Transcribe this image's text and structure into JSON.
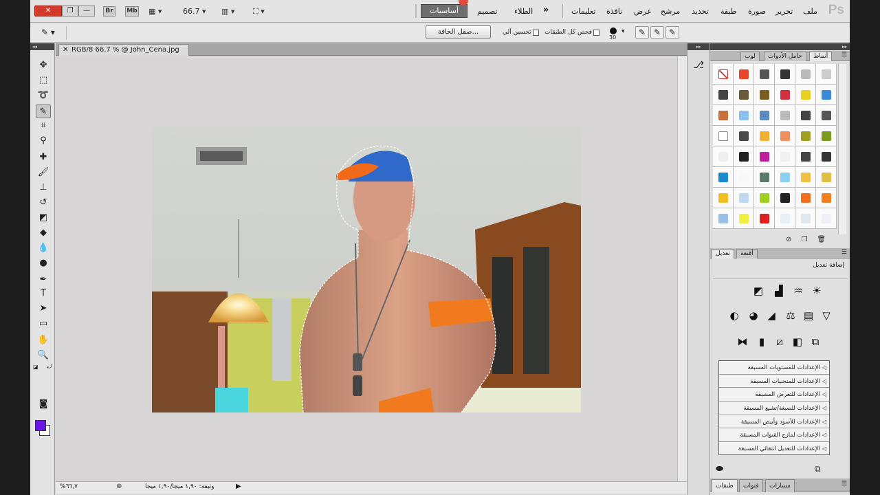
{
  "menubar": {
    "close_glyph": "✕",
    "restore_glyph": "❐",
    "minimize_glyph": "—",
    "bridge_label": "Br",
    "minibridge_label": "Mb",
    "zoom_value": "66.7",
    "workspace_active": "أساسيات",
    "workspace_design": "تصميم",
    "workspace_more": "الطلاء",
    "more_glyph": "»",
    "items": [
      "تعليمات",
      "نافذة",
      "عرض",
      "مرشح",
      "تحديد",
      "طبقة",
      "صورة",
      "تحرير",
      "ملف"
    ],
    "ps_logo": "Ps"
  },
  "options": {
    "refine_edge": "صقل الحافة...",
    "auto_enhance": "تحسين آلي",
    "sample_all": "فحص كل الطبقات",
    "brush_size": "30"
  },
  "document": {
    "tab_title": "RGB/8 66.7 % @ John_Cena.jpg",
    "close_glyph": "✕"
  },
  "status": {
    "zoom": "%٦٦,٧",
    "doc_size": "وثيقة: ١,٩٠ ميجا/١,٩٠ ميجا"
  },
  "panels": {
    "top_tabs": [
      "أنماط",
      "حامل الأدوات",
      "لوب"
    ],
    "adj_tabs": [
      "تعديل",
      "أقنعة"
    ],
    "adj_add": "إضافة تعديل",
    "presets": [
      "الإعدادات للمستويات المسبقة",
      "الإعدادات للمنحنيات المسبقة",
      "الإعدادات للتعرض المسبقة",
      "الإعدادات للصبغة/تشبع المسبقة",
      "الإعدادات للأسود وأبيض المسبقة",
      "الإعدادات لمازج القنوات المسبقة",
      "الإعدادات للتعديل انتقائي المسبقة"
    ],
    "bottom_tabs": [
      "طبقات",
      "قنوات",
      "مسارات"
    ]
  },
  "colors": {
    "foreground": "#6a14e8",
    "background": "#ffffff"
  }
}
